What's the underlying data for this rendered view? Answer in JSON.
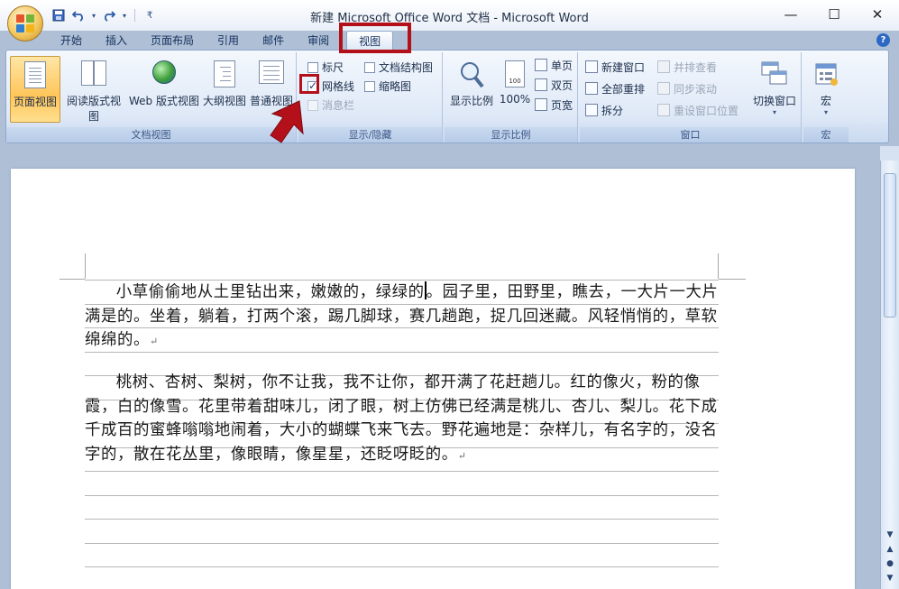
{
  "window": {
    "title": "新建 Microsoft Office Word 文档 - Microsoft Word",
    "controls": {
      "minimize": "—",
      "maximize": "☐",
      "close": "✕"
    }
  },
  "qat": {
    "customize": "₹"
  },
  "tabs": [
    {
      "label": "开始"
    },
    {
      "label": "插入"
    },
    {
      "label": "页面布局"
    },
    {
      "label": "引用"
    },
    {
      "label": "邮件"
    },
    {
      "label": "审阅"
    },
    {
      "label": "视图",
      "active": true
    }
  ],
  "help": "?",
  "ribbon": {
    "doc_views": {
      "label": "文档视图",
      "buttons": [
        "页面视图",
        "阅读版式视图",
        "Web 版式视图",
        "大纲视图",
        "普通视图"
      ]
    },
    "show_hide": {
      "label": "显示/隐藏",
      "ruler": {
        "label": "标尺",
        "checked": false
      },
      "gridlines": {
        "label": "网格线",
        "checked": true
      },
      "message_bar": {
        "label": "消息栏",
        "checked": false,
        "disabled": true
      },
      "doc_map": {
        "label": "文档结构图",
        "checked": false
      },
      "thumbnails": {
        "label": "缩略图",
        "checked": false
      }
    },
    "zoom": {
      "label": "显示比例",
      "zoom_btn": "显示比例",
      "hundred_btn": "100%",
      "one_page": "单页",
      "two_pages": "双页",
      "page_width": "页宽"
    },
    "window": {
      "label": "窗口",
      "new_window": "新建窗口",
      "arrange_all": "全部重排",
      "split": "拆分",
      "side_by_side": "并排查看",
      "sync_scroll": "同步滚动",
      "reset_position": "重设窗口位置",
      "switch_windows": "切换窗口"
    },
    "macros": {
      "label": "宏",
      "button": "宏"
    }
  },
  "document": {
    "para1_before_cursor": "小草偷偷地从土里钻出来，嫩嫩的，绿绿的",
    "para1_after_cursor": "。园子里，田野里，瞧去，一大片一大片满是的。坐着，躺着，打两个滚，踢几脚球，赛几趟跑，捉几回迷藏。风轻悄悄的，草软绵绵的。",
    "para2": "桃树、杏树、梨树，你不让我，我不让你，都开满了花赶趟儿。红的像火，粉的像霞，白的像雪。花里带着甜味儿，闭了眼，树上仿佛已经满是桃儿、杏儿、梨儿。花下成千成百的蜜蜂嗡嗡地闹着，大小的蝴蝶飞来飞去。野花遍地是：杂样儿，有名字的，没名字的，散在花丛里，像眼睛，像星星，还眨呀眨的。",
    "paragraph_mark": "↵"
  },
  "colors": {
    "highlight": "#b3101a",
    "ribbon_bg": "#dfe9f7",
    "workspace_bg": "#aebfd6"
  }
}
